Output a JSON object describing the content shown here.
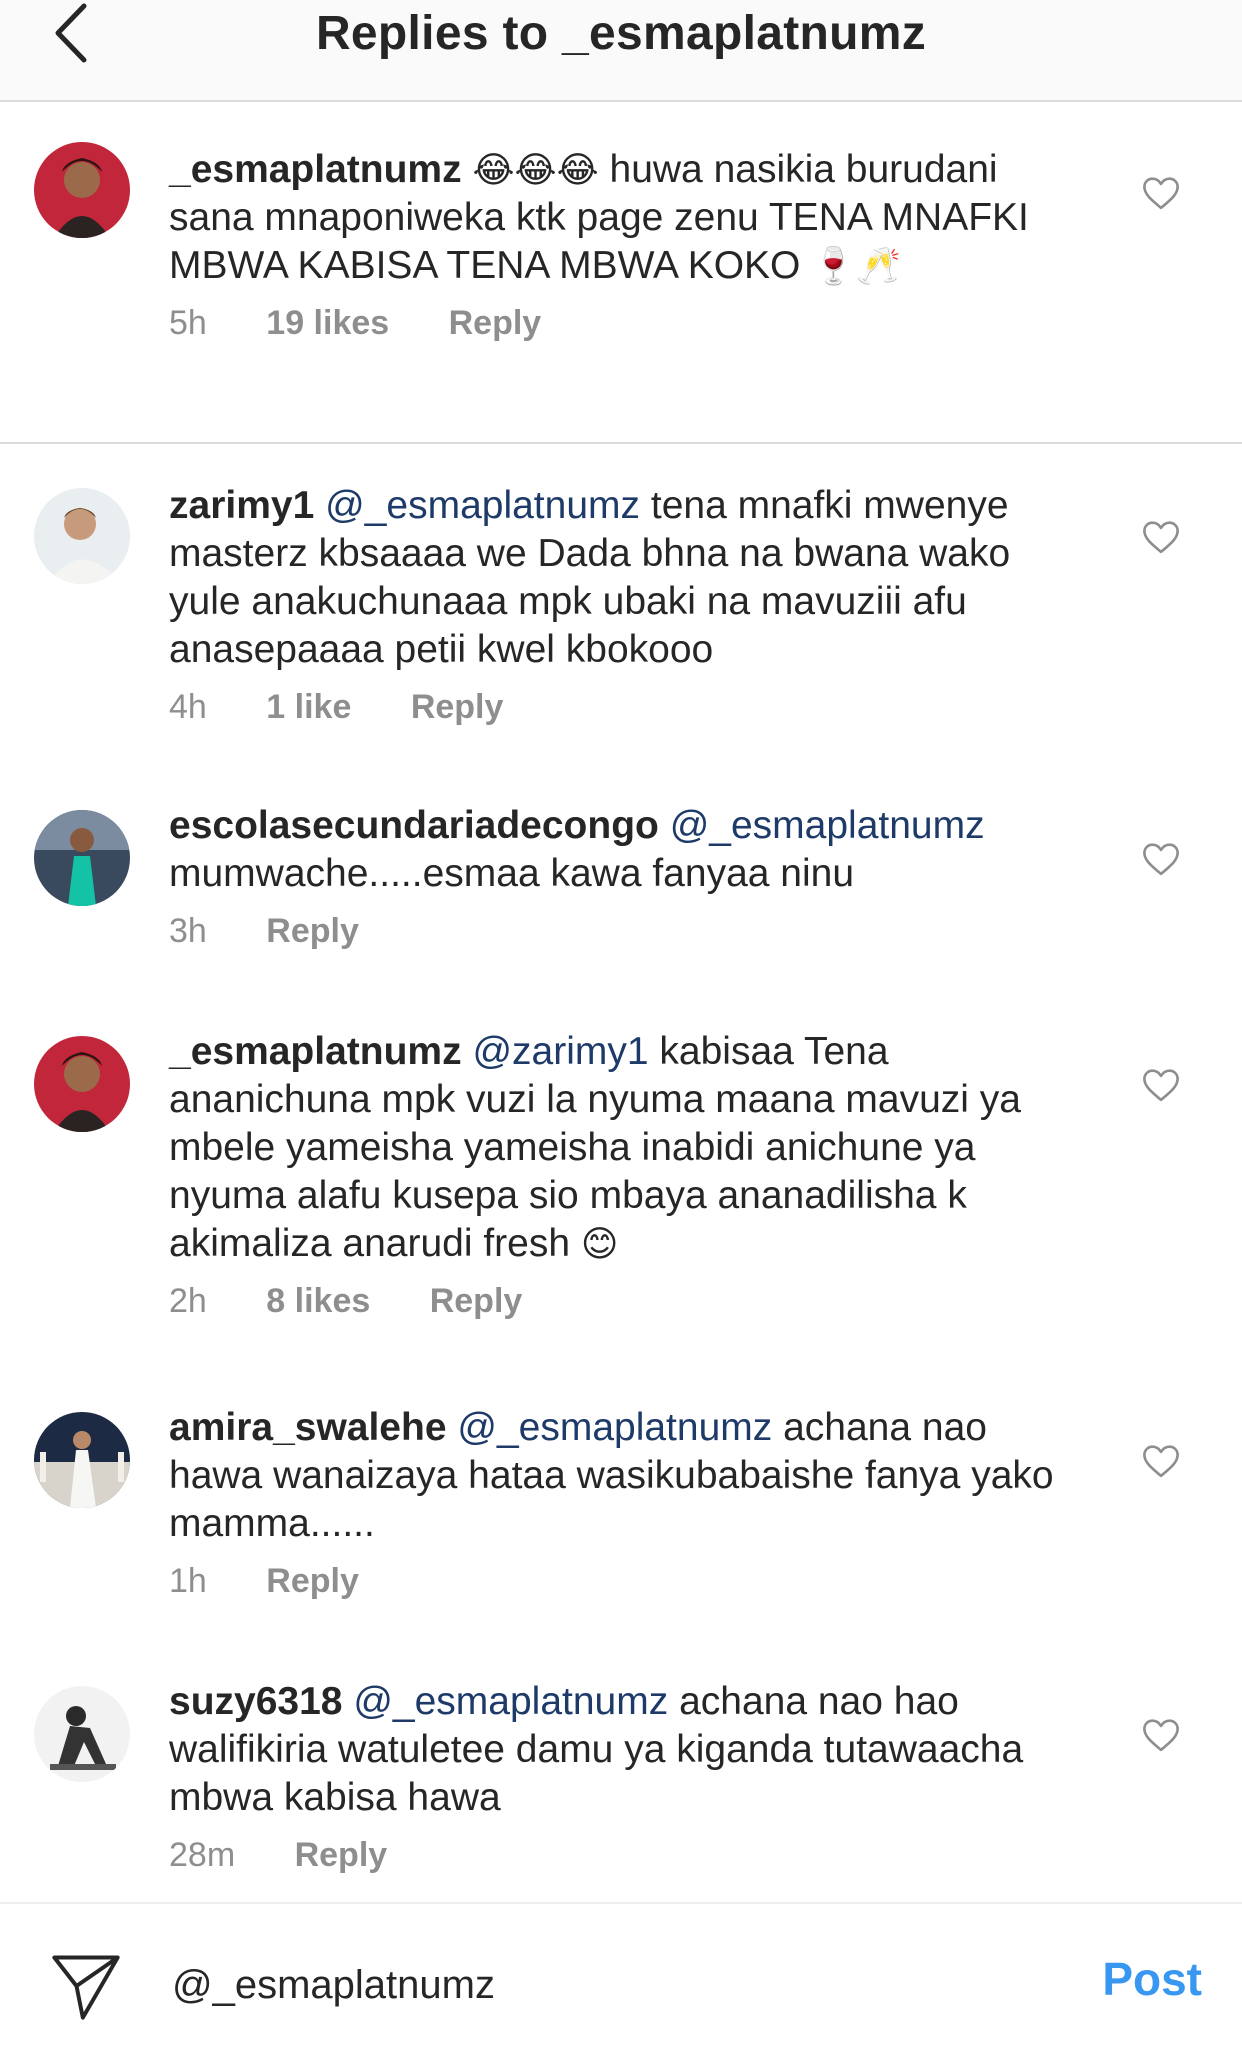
{
  "header": {
    "title": "Replies to _esmaplatnumz"
  },
  "comments": [
    {
      "username": "_esmaplatnumz",
      "mention": "",
      "text": "huwa nasikia burudani sana mnaponiweka ktk page zenu TENA MNAFKI MBWA KABISA TENA MBWA KOKO",
      "emoji_before": "😂😂😂",
      "emoji_after": "🍷🥂",
      "time": "5h",
      "likes": "19 likes",
      "reply": "Reply"
    },
    {
      "username": "zarimy1",
      "mention": "@_esmaplatnumz",
      "text": "tena mnafki mwenye masterz kbsaaaa we Dada bhna na bwana wako yule anakuchunaaa mpk ubaki na mavuziii afu anasepaaaa petii kwel kbokooo",
      "time": "4h",
      "likes": "1 like",
      "reply": "Reply"
    },
    {
      "username": "escolasecundariadecongo",
      "mention": "@_esmaplatnumz",
      "text": "mumwache.....esmaa kawa fanyaa ninu",
      "time": "3h",
      "reply": "Reply"
    },
    {
      "username": "_esmaplatnumz",
      "mention": "@zarimy1",
      "text": "kabisaa Tena ananichuna mpk vuzi la nyuma maana mavuzi ya mbele yameisha yameisha inabidi anichune ya nyuma alafu kusepa sio mbaya ananadilisha k akimaliza anarudi fresh",
      "emoji_after": "😊",
      "time": "2h",
      "likes": "8 likes",
      "reply": "Reply"
    },
    {
      "username": "amira_swalehe",
      "mention": "@_esmaplatnumz",
      "text": "achana nao hawa wanaizaya hataa wasikubabaishe fanya yako mamma......",
      "time": "1h",
      "reply": "Reply"
    },
    {
      "username": "suzy6318",
      "mention": "@_esmaplatnumz",
      "text": "achana nao hao walifikiria watuletee damu ya kiganda tutawaacha mbwa kabisa hawa",
      "time": "28m",
      "reply": "Reply"
    }
  ],
  "composer": {
    "value": "@_esmaplatnumz",
    "post_label": "Post"
  },
  "icons": {
    "back": "chevron-left-icon",
    "like": "heart-outline-icon",
    "send": "paper-plane-icon"
  },
  "colors": {
    "text": "#262626",
    "secondary": "#8e8e8e",
    "mention": "#1e3a68",
    "post": "#3897f0",
    "divider": "#dbdbdb"
  }
}
